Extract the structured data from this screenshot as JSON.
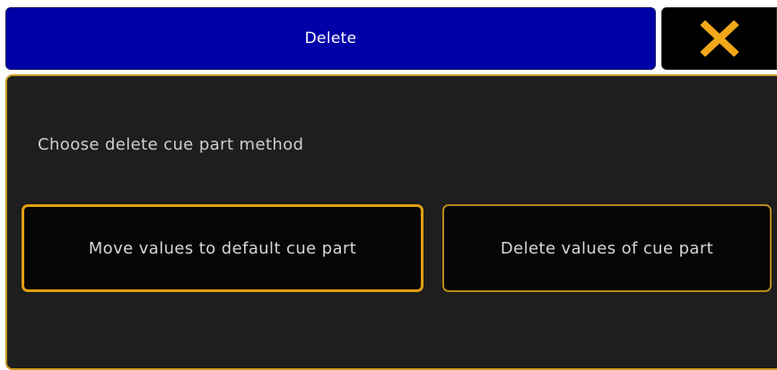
{
  "dialog": {
    "title": "Delete",
    "close_icon": "close-icon",
    "prompt": "Choose delete cue part method",
    "options": [
      {
        "label": "Move values to default cue part",
        "selected": true
      },
      {
        "label": "Delete values of cue part",
        "selected": false
      }
    ]
  },
  "colors": {
    "title_bar": "#0000a8",
    "accent": "#e0a010",
    "close_x": "#f0a818",
    "panel_bg": "#1e1e1e"
  }
}
